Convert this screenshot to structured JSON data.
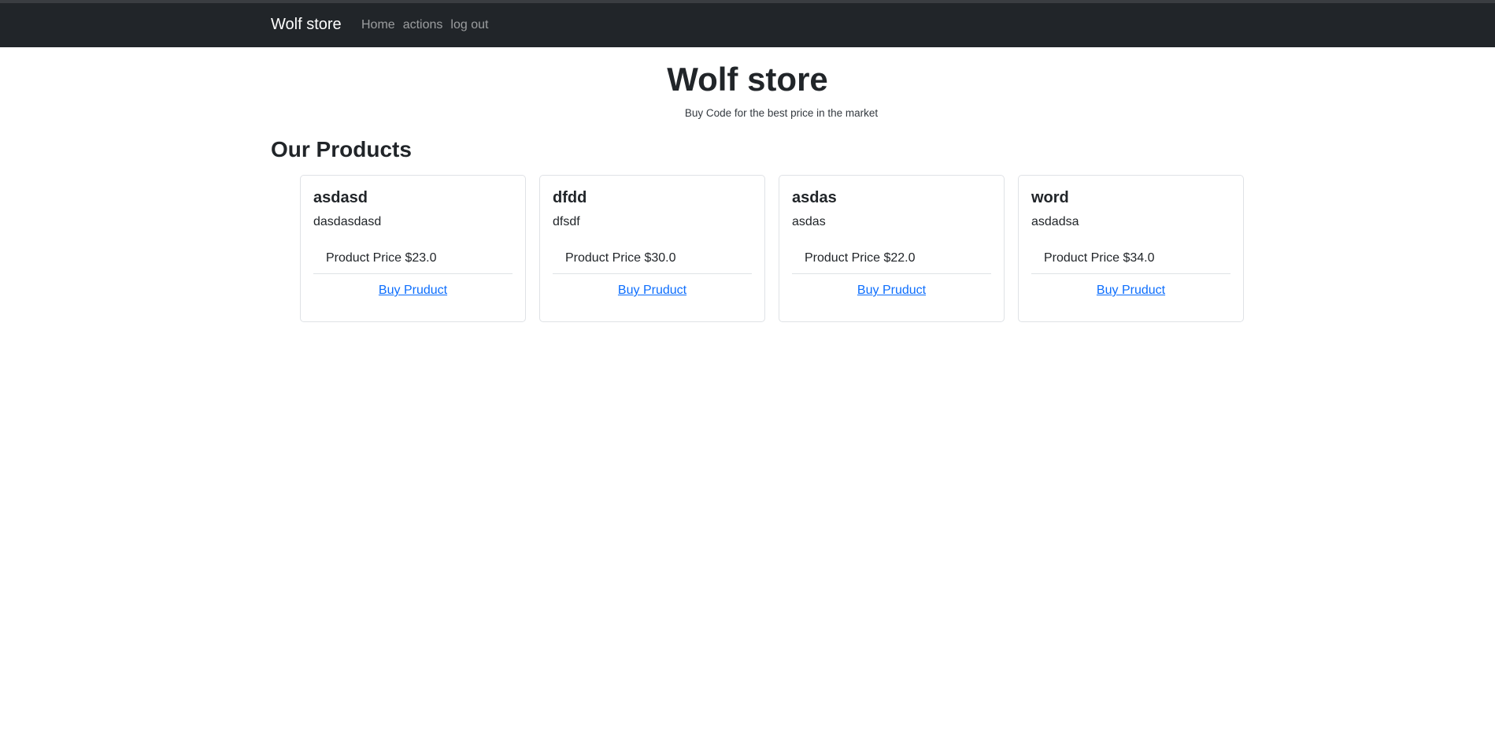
{
  "navbar": {
    "brand": "Wolf store",
    "links": [
      "Home",
      "actions",
      "log out"
    ]
  },
  "hero": {
    "title": "Wolf store",
    "subtitle": "Buy Code for the best price in the market"
  },
  "section": {
    "title": "Our Products"
  },
  "products": [
    {
      "name": "asdasd",
      "description": "dasdasdasd",
      "price": "Product Price $23.0",
      "buy_label": "Buy Pruduct"
    },
    {
      "name": "dfdd",
      "description": "dfsdf",
      "price": "Product Price $30.0",
      "buy_label": "Buy Pruduct"
    },
    {
      "name": "asdas",
      "description": "asdas",
      "price": "Product Price $22.0",
      "buy_label": "Buy Pruduct"
    },
    {
      "name": "word",
      "description": "asdadsa",
      "price": "Product Price $34.0",
      "buy_label": "Buy Pruduct"
    }
  ]
}
